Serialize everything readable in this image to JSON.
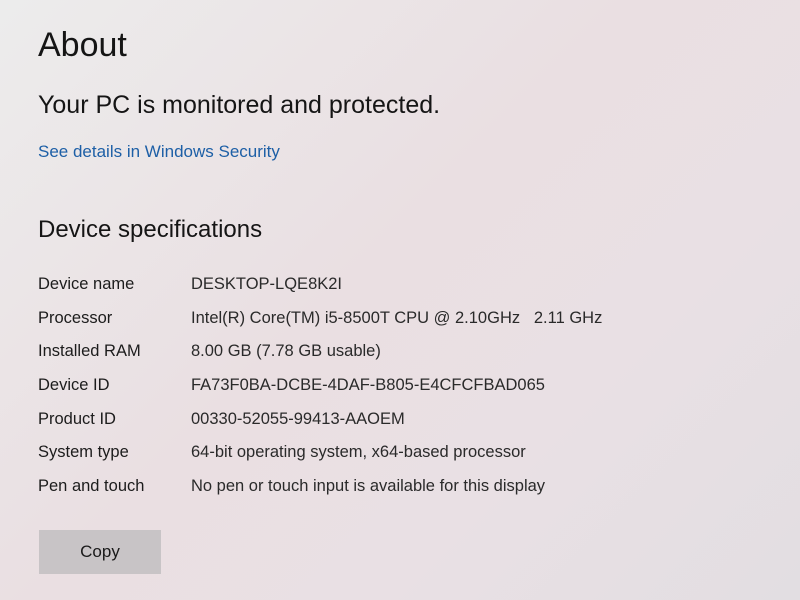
{
  "header": {
    "title": "About"
  },
  "security": {
    "status": "Your PC is monitored and protected.",
    "link_label": "See details in Windows Security"
  },
  "device_specs": {
    "heading": "Device specifications",
    "rows": [
      {
        "label": "Device name",
        "value": "DESKTOP-LQE8K2I"
      },
      {
        "label": "Processor",
        "value": "Intel(R) Core(TM) i5-8500T CPU @ 2.10GHz   2.11 GHz"
      },
      {
        "label": "Installed RAM",
        "value": "8.00 GB (7.78 GB usable)"
      },
      {
        "label": "Device ID",
        "value": "FA73F0BA-DCBE-4DAF-B805-E4CFCFBAD065"
      },
      {
        "label": "Product ID",
        "value": "00330-52055-99413-AAOEM"
      },
      {
        "label": "System type",
        "value": "64-bit operating system, x64-based processor"
      },
      {
        "label": "Pen and touch",
        "value": "No pen or touch input is available for this display"
      }
    ],
    "copy_label": "Copy"
  },
  "colors": {
    "link": "#1d5fa6",
    "button_bg": "#c8c4c6"
  }
}
